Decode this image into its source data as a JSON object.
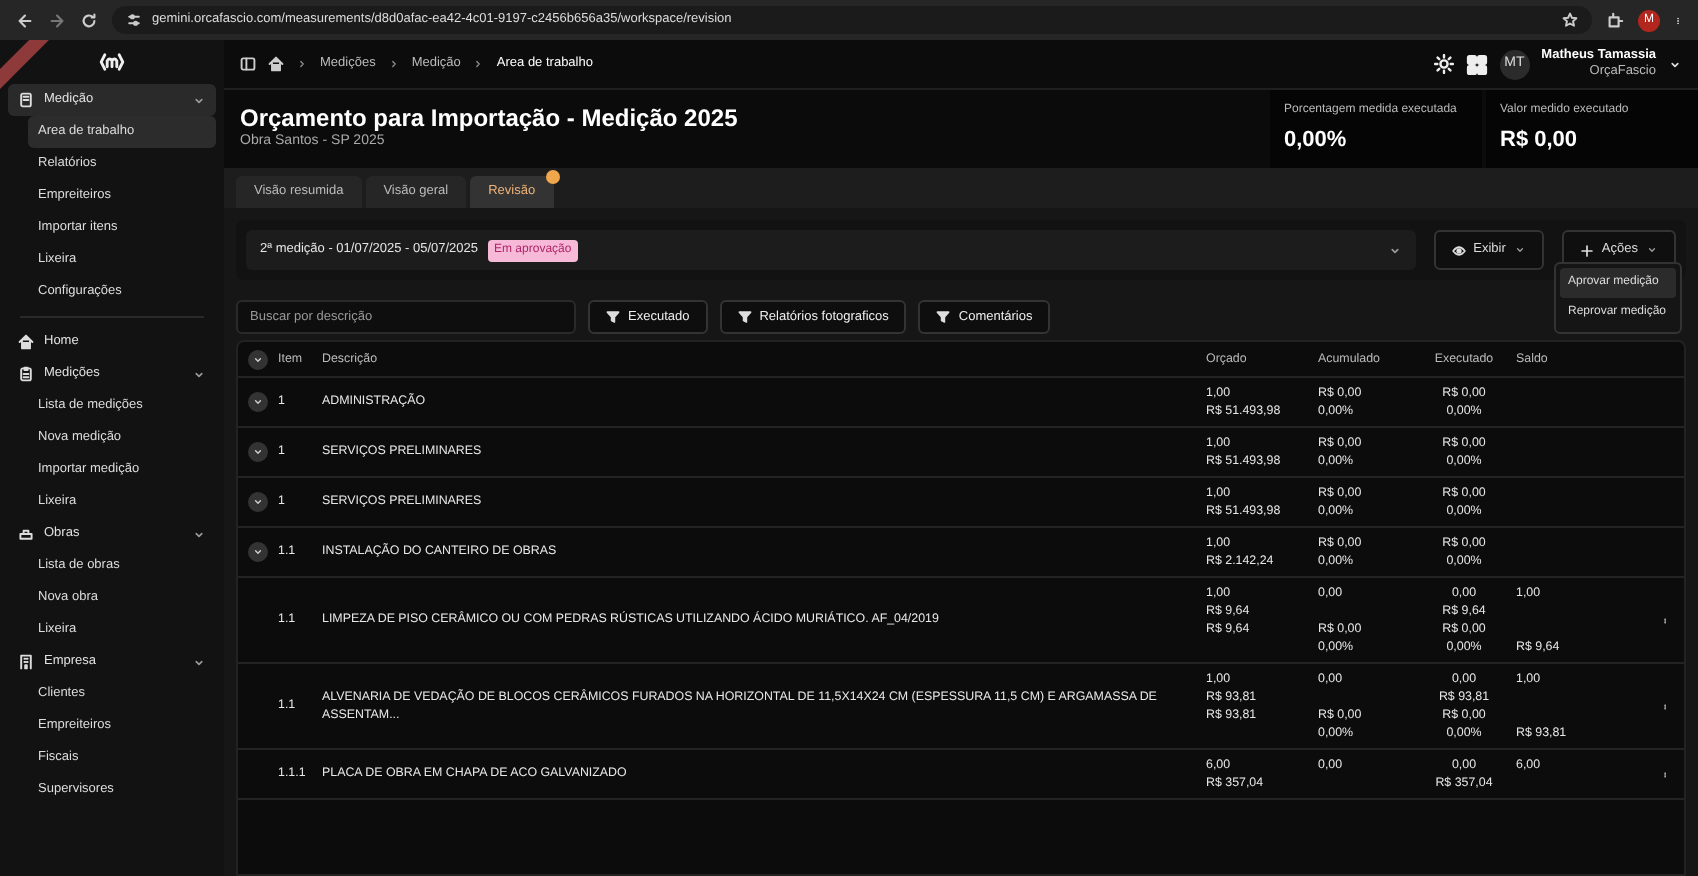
{
  "browser": {
    "url": "gemini.orcafascio.com/measurements/d8d0afac-ea42-4c01-9197-c2456b656a35/workspace/revision",
    "profile": "M"
  },
  "sidebar": {
    "sections": [
      {
        "label": "Medição",
        "selected": true,
        "expanded": true,
        "children": [
          {
            "label": "Area de trabalho",
            "selected": true
          },
          {
            "label": "Relatórios",
            "selected": false
          },
          {
            "label": "Empreiteiros",
            "selected": false
          },
          {
            "label": "Importar itens",
            "selected": false
          },
          {
            "label": "Lixeira",
            "selected": false
          },
          {
            "label": "Configurações",
            "selected": false
          }
        ]
      },
      {
        "label": "Home",
        "selected": false
      },
      {
        "label": "Medições",
        "selected": false,
        "expanded": true,
        "children": [
          {
            "label": "Lista de medições",
            "selected": false
          },
          {
            "label": "Nova medição",
            "selected": false
          },
          {
            "label": "Importar medição",
            "selected": false
          },
          {
            "label": "Lixeira",
            "selected": false
          }
        ]
      },
      {
        "label": "Obras",
        "selected": false,
        "expanded": true,
        "children": [
          {
            "label": "Lista de obras",
            "selected": false
          },
          {
            "label": "Nova obra",
            "selected": false
          },
          {
            "label": "Lixeira",
            "selected": false
          }
        ]
      },
      {
        "label": "Empresa",
        "selected": false,
        "expanded": true,
        "children": [
          {
            "label": "Clientes",
            "selected": false
          },
          {
            "label": "Empreiteiros",
            "selected": false
          },
          {
            "label": "Fiscais",
            "selected": false
          },
          {
            "label": "Supervisores",
            "selected": false
          }
        ]
      }
    ]
  },
  "breadcrumb": [
    "Medições",
    "Medição",
    "Area de trabalho"
  ],
  "user": {
    "initials": "MT",
    "name": "Matheus Tamassia",
    "company": "OrçaFascio"
  },
  "header": {
    "title": "Orçamento para Importação - Medição 2025",
    "subtitle": "Obra Santos - SP 2025",
    "stats": [
      {
        "label": "Porcentagem medida executada",
        "value": "0,00%"
      },
      {
        "label": "Valor medido executado",
        "value": "R$ 0,00"
      }
    ]
  },
  "tabs": [
    {
      "label": "Visão resumida",
      "selected": false,
      "notification": false
    },
    {
      "label": "Visão geral",
      "selected": false,
      "notification": false
    },
    {
      "label": "Revisão",
      "selected": true,
      "notification": true
    }
  ],
  "measurement": {
    "label": "2ª medição - 01/07/2025 - 05/07/2025",
    "status": "Em aprovação"
  },
  "actions": [
    {
      "label": "Exibir",
      "kind": "view"
    },
    {
      "label": "Ações",
      "kind": "add"
    }
  ],
  "menu": [
    {
      "label": "Aprovar medição",
      "selected": true
    },
    {
      "label": "Reprovar medição",
      "selected": false
    }
  ],
  "search": {
    "placeholder": "Buscar por descrição"
  },
  "filters": [
    "Executado",
    "Relatórios fotograficos",
    "Comentários"
  ],
  "table": {
    "columns": [
      "Item",
      "Descrição",
      "Orçado",
      "Acumulado",
      "Executado",
      "Saldo"
    ],
    "rows": [
      {
        "item": "1",
        "description": "ADMINISTRAÇÃO",
        "expandable": true,
        "has_menu": false,
        "orcado": {
          "upper": [
            "1,00",
            "R$ 51.493,98"
          ]
        },
        "acumulado": {
          "lower": [
            "R$ 0,00",
            "0,00%"
          ]
        },
        "executado": {
          "upper": [
            "R$ 0,00",
            "0,00%"
          ]
        }
      },
      {
        "item": "1",
        "description": "SERVIÇOS PRELIMINARES",
        "expandable": true,
        "has_menu": false,
        "orcado": {
          "upper": [
            "1,00",
            "R$ 51.493,98"
          ]
        },
        "acumulado": {
          "lower": [
            "R$ 0,00",
            "0,00%"
          ]
        },
        "executado": {
          "upper": [
            "R$ 0,00",
            "0,00%"
          ]
        }
      },
      {
        "item": "1",
        "description": "SERVIÇOS PRELIMINARES",
        "expandable": true,
        "has_menu": false,
        "orcado": {
          "upper": [
            "1,00",
            "R$ 51.493,98"
          ]
        },
        "acumulado": {
          "lower": [
            "R$ 0,00",
            "0,00%"
          ]
        },
        "executado": {
          "upper": [
            "R$ 0,00",
            "0,00%"
          ]
        }
      },
      {
        "item": "1.1",
        "description": "INSTALAÇÃO DO CANTEIRO DE OBRAS",
        "expandable": true,
        "has_menu": false,
        "orcado": {
          "upper": [
            "1,00",
            "R$ 2.142,24"
          ]
        },
        "acumulado": {
          "lower": [
            "R$ 0,00",
            "0,00%"
          ]
        },
        "executado": {
          "upper": [
            "R$ 0,00",
            "0,00%"
          ]
        }
      },
      {
        "item": "1.1",
        "description": "LIMPEZA DE PISO CERÂMICO OU COM PEDRAS RÚSTICAS UTILIZANDO ÁCIDO MURIÁTICO. AF_04/2019",
        "expandable": false,
        "has_menu": true,
        "orcado": {
          "upper": [
            "1,00",
            "R$ 9,64",
            "R$ 9,64"
          ]
        },
        "acumulado": {
          "upper": [
            "0,00"
          ],
          "lower": [
            "R$ 0,00",
            "0,00%"
          ]
        },
        "executado": {
          "upper": [
            "0,00",
            "R$ 9,64",
            "R$ 0,00",
            "0,00%"
          ]
        },
        "saldo": {
          "upper": [
            "1,00"
          ],
          "lower": [
            "R$ 9,64"
          ]
        }
      },
      {
        "item": "1.1",
        "description": "ALVENARIA DE VEDAÇÃO DE BLOCOS CERÂMICOS FURADOS NA HORIZONTAL DE 11,5X14X24 CM (ESPESSURA 11,5 CM) E ARGAMASSA DE ASSENTAM...",
        "expandable": false,
        "has_menu": true,
        "orcado": {
          "upper": [
            "1,00",
            "R$ 93,81",
            "R$ 93,81"
          ]
        },
        "acumulado": {
          "upper": [
            "0,00"
          ],
          "lower": [
            "R$ 0,00",
            "0,00%"
          ]
        },
        "executado": {
          "upper": [
            "0,00",
            "R$ 93,81",
            "R$ 0,00",
            "0,00%"
          ]
        },
        "saldo": {
          "upper": [
            "1,00"
          ],
          "lower": [
            "R$ 93,81"
          ]
        }
      },
      {
        "item": "1.1.1",
        "description": "PLACA DE OBRA EM CHAPA DE ACO GALVANIZADO",
        "expandable": false,
        "has_menu": true,
        "orcado": {
          "upper": [
            "6,00",
            "R$ 357,04"
          ]
        },
        "acumulado": {
          "upper": [
            "0,00"
          ]
        },
        "executado": {
          "upper": [
            "0,00",
            "R$ 357,04"
          ]
        },
        "saldo": {
          "upper": [
            "6,00"
          ]
        }
      }
    ]
  }
}
